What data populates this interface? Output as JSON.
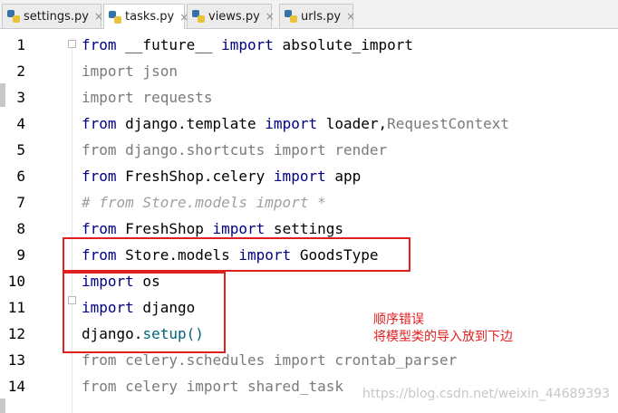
{
  "tabs": [
    {
      "label": "settings.py",
      "close": "×"
    },
    {
      "label": "tasks.py",
      "close": "×"
    },
    {
      "label": "views.py",
      "close": "×"
    },
    {
      "label": "urls.py",
      "close": "×"
    }
  ],
  "editor": {
    "lines": [
      {
        "num": "1",
        "tokens": [
          {
            "t": "from",
            "c": "kw"
          },
          {
            "t": " __future__ ",
            "c": "plain"
          },
          {
            "t": "import",
            "c": "kw"
          },
          {
            "t": " absolute_import",
            "c": "plain"
          }
        ]
      },
      {
        "num": "2",
        "tokens": [
          {
            "t": "import json",
            "c": "dim"
          }
        ]
      },
      {
        "num": "3",
        "tokens": [
          {
            "t": "import requests",
            "c": "dim"
          }
        ]
      },
      {
        "num": "4",
        "tokens": [
          {
            "t": "from",
            "c": "kw"
          },
          {
            "t": " django.template ",
            "c": "plain"
          },
          {
            "t": "import",
            "c": "kw"
          },
          {
            "t": " loader,",
            "c": "plain"
          },
          {
            "t": "RequestContext",
            "c": "dim"
          }
        ]
      },
      {
        "num": "5",
        "tokens": [
          {
            "t": "from django.shortcuts import render",
            "c": "dim"
          }
        ]
      },
      {
        "num": "6",
        "tokens": [
          {
            "t": "from",
            "c": "kw"
          },
          {
            "t": " FreshShop.celery ",
            "c": "plain"
          },
          {
            "t": "import",
            "c": "kw"
          },
          {
            "t": " app",
            "c": "plain"
          }
        ]
      },
      {
        "num": "7",
        "tokens": [
          {
            "t": "# from Store.models import *",
            "c": "cm"
          }
        ]
      },
      {
        "num": "8",
        "tokens": [
          {
            "t": "from",
            "c": "kw"
          },
          {
            "t": " FreshShop ",
            "c": "plain"
          },
          {
            "t": "import",
            "c": "kw"
          },
          {
            "t": " settings",
            "c": "plain"
          }
        ]
      },
      {
        "num": "9",
        "tokens": [
          {
            "t": "from",
            "c": "kw"
          },
          {
            "t": " Store.models ",
            "c": "plain"
          },
          {
            "t": "import",
            "c": "kw"
          },
          {
            "t": " GoodsType",
            "c": "plain"
          }
        ]
      },
      {
        "num": "10",
        "tokens": [
          {
            "t": "import",
            "c": "kw"
          },
          {
            "t": " os",
            "c": "plain"
          }
        ]
      },
      {
        "num": "11",
        "tokens": [
          {
            "t": "import",
            "c": "kw"
          },
          {
            "t": " django",
            "c": "plain"
          }
        ]
      },
      {
        "num": "12",
        "tokens": [
          {
            "t": "django.",
            "c": "plain"
          },
          {
            "t": "setup()",
            "c": "fn"
          }
        ]
      },
      {
        "num": "13",
        "tokens": [
          {
            "t": "from celery.schedules import crontab_parser",
            "c": "dim"
          }
        ]
      },
      {
        "num": "14",
        "tokens": [
          {
            "t": "from celery import shared_task",
            "c": "dim"
          }
        ]
      }
    ]
  },
  "annotation": {
    "line1": "顺序错误",
    "line2": "将模型类的导入放到下边"
  },
  "watermark": "https://blog.csdn.net/weixin_44689393",
  "colors": {
    "keyword": "#000080",
    "unused": "#7a7a7a",
    "annotation": "#e02020"
  }
}
